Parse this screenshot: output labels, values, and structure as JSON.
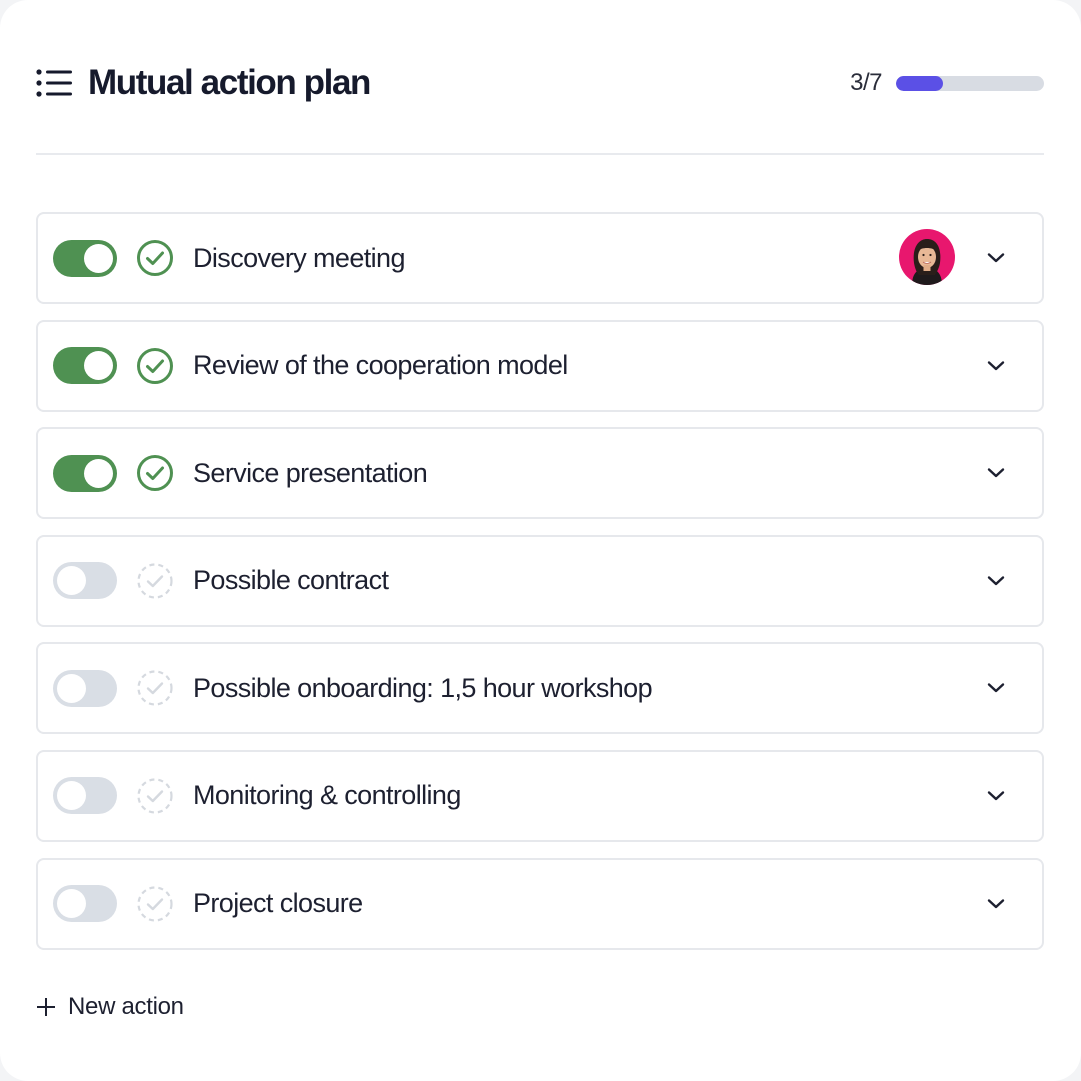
{
  "header": {
    "title": "Mutual action plan",
    "icon": "list-icon",
    "progress": {
      "label": "3/7",
      "completed": 3,
      "total": 7,
      "fraction": 0.32,
      "fill_color": "#5b50e6",
      "track_color": "#d8dce3"
    }
  },
  "actions": [
    {
      "label": "Discovery meeting",
      "done": true,
      "has_avatar": true
    },
    {
      "label": "Review of the cooperation model",
      "done": true,
      "has_avatar": false
    },
    {
      "label": "Service presentation",
      "done": true,
      "has_avatar": false
    },
    {
      "label": "Possible contract",
      "done": false,
      "has_avatar": false
    },
    {
      "label": "Possible onboarding: 1,5 hour workshop",
      "done": false,
      "has_avatar": false
    },
    {
      "label": "Monitoring & controlling",
      "done": false,
      "has_avatar": false
    },
    {
      "label": "Project closure",
      "done": false,
      "has_avatar": false
    }
  ],
  "new_action": {
    "label": "New action",
    "icon": "plus-icon"
  },
  "colors": {
    "toggle_on": "#4f9152",
    "toggle_off": "#d9dee5",
    "check_done": "#4f9152",
    "check_pending": "#d5d9df",
    "avatar_bg": "#e8176e"
  }
}
